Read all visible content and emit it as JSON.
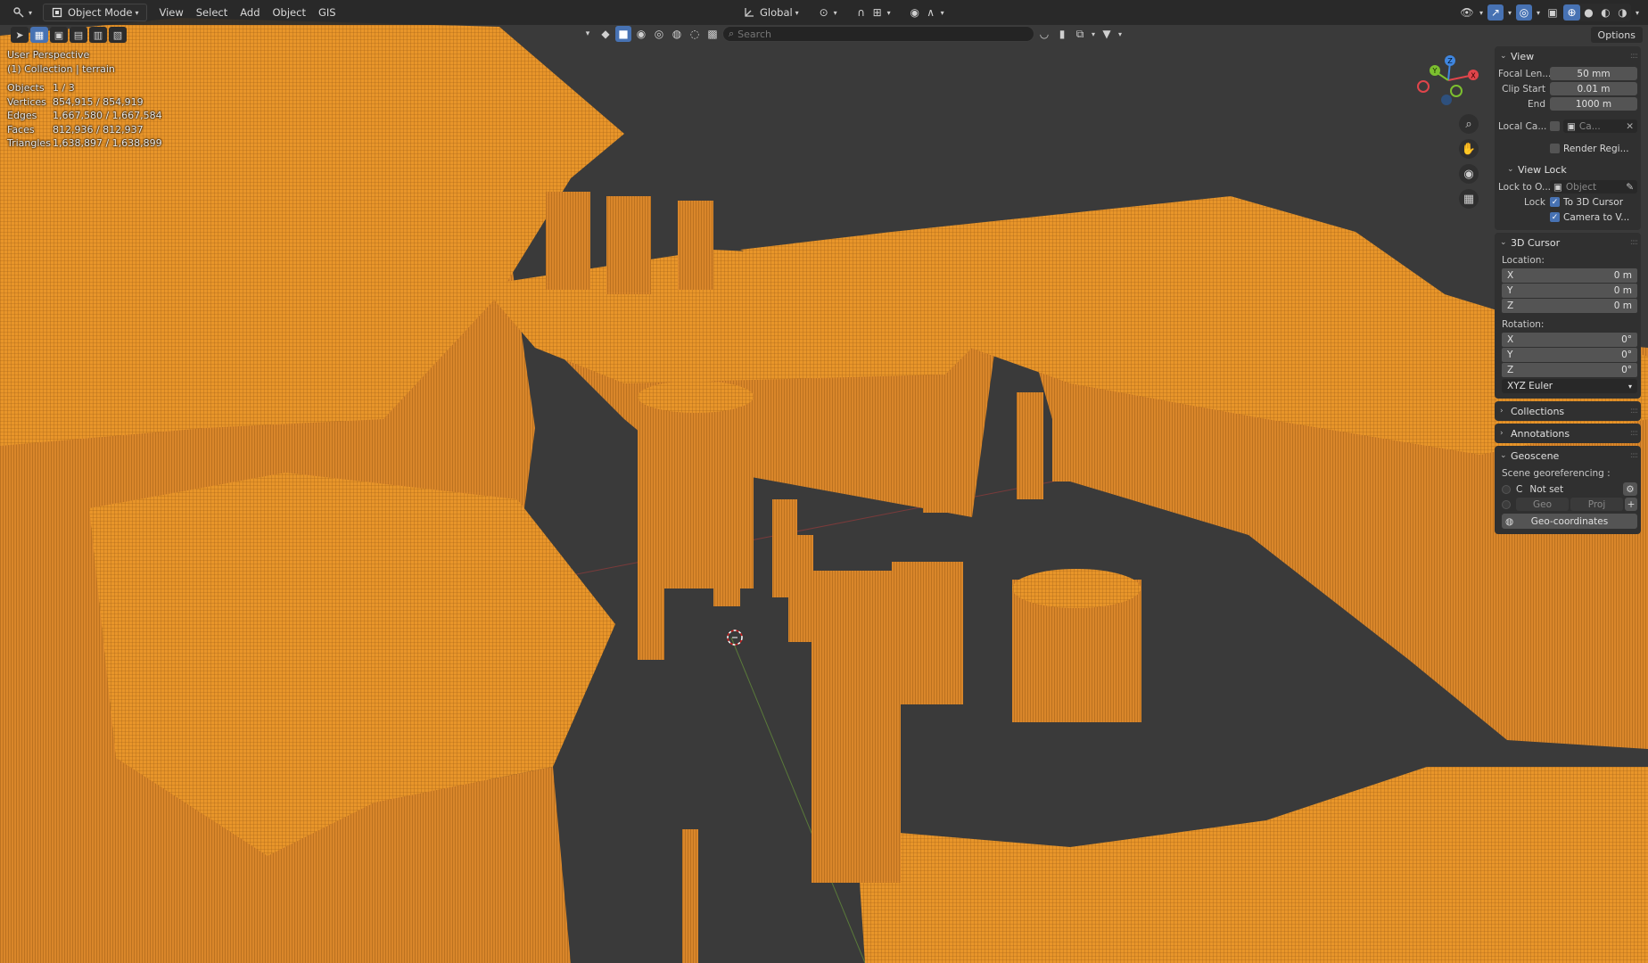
{
  "header": {
    "mode": "Object Mode",
    "menus": [
      "View",
      "Select",
      "Add",
      "Object",
      "GIS"
    ],
    "orientation": "Global"
  },
  "search": {
    "placeholder": "Search"
  },
  "options_label": "Options",
  "overlay": {
    "view_name": "User Perspective",
    "collection_line": "(1) Collection | terrain",
    "stats": [
      {
        "label": "Objects",
        "value": "1 / 3"
      },
      {
        "label": "Vertices",
        "value": "854,915 / 854,919"
      },
      {
        "label": "Edges",
        "value": "1,667,580 / 1,667,584"
      },
      {
        "label": "Faces",
        "value": "812,936 / 812,937"
      },
      {
        "label": "Triangles",
        "value": "1,638,897 / 1,638,899"
      }
    ]
  },
  "gizmo": {
    "x_label": "X",
    "y_label": "Y",
    "z_label": "Z"
  },
  "sidebar": {
    "view": {
      "title": "View",
      "focal_label": "Focal Len...",
      "focal_value": "50 mm",
      "clip_start_label": "Clip Start",
      "clip_start_value": "0.01 m",
      "end_label": "End",
      "end_value": "1000 m",
      "local_camera_label": "Local Ca...",
      "local_camera_value": "Ca...",
      "render_region_label": "Render Regi..."
    },
    "view_lock": {
      "title": "View Lock",
      "lock_to_label": "Lock to O...",
      "lock_to_placeholder": "Object",
      "lock_label": "Lock",
      "to_cursor_label": "To 3D Cursor",
      "camera_to_view_label": "Camera to V..."
    },
    "cursor": {
      "title": "3D Cursor",
      "location_label": "Location:",
      "location": [
        {
          "axis": "X",
          "value": "0 m"
        },
        {
          "axis": "Y",
          "value": "0 m"
        },
        {
          "axis": "Z",
          "value": "0 m"
        }
      ],
      "rotation_label": "Rotation:",
      "rotation": [
        {
          "axis": "X",
          "value": "0°"
        },
        {
          "axis": "Y",
          "value": "0°"
        },
        {
          "axis": "Z",
          "value": "0°"
        }
      ],
      "rotation_mode": "XYZ Euler"
    },
    "collections": {
      "title": "Collections"
    },
    "annotations": {
      "title": "Annotations"
    },
    "geoscene": {
      "title": "Geoscene",
      "georef_label": "Scene georeferencing :",
      "crs_letter": "C",
      "crs_value": "Not set",
      "geo_label": "Geo",
      "proj_label": "Proj",
      "geo_coords_label": "Geo-coordinates"
    }
  },
  "colors": {
    "terrain": "#e8952a",
    "terrain_dark": "#b86d1a",
    "viewport_bg": "#3a3a3a",
    "accent": "#4772b3",
    "x_axis": "#e0454b",
    "y_axis": "#7cbf2f",
    "z_axis": "#3f86e0"
  }
}
